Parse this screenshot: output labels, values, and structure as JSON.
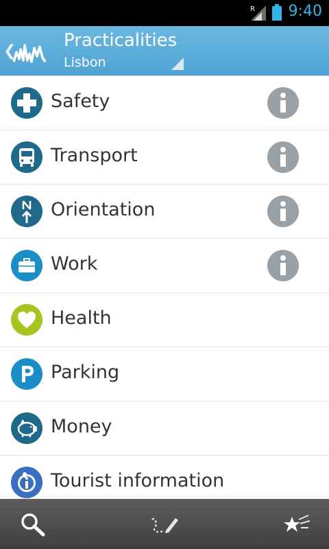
{
  "status_bar": {
    "time": "9:40",
    "signal_glyph": "R"
  },
  "app_bar": {
    "title": "Practicalities",
    "subtitle": "Lisbon",
    "logo_icon": "skyline-logo-icon",
    "back_icon": "chevron-left-icon"
  },
  "list": {
    "items": [
      {
        "label": "Safety",
        "icon": "plus-icon",
        "icon_color": "#1f6a8a",
        "has_info": true
      },
      {
        "label": "Transport",
        "icon": "bus-icon",
        "icon_color": "#1f6a8a",
        "has_info": true
      },
      {
        "label": "Orientation",
        "icon": "north-arrow-icon",
        "icon_color": "#1f6a8a",
        "has_info": true
      },
      {
        "label": "Work",
        "icon": "briefcase-icon",
        "icon_color": "#1b8ec8",
        "has_info": true
      },
      {
        "label": "Health",
        "icon": "heart-icon",
        "icon_color": "#a7c520",
        "has_info": false
      },
      {
        "label": "Parking",
        "icon": "parking-icon",
        "icon_color": "#1b8ec8",
        "has_info": false
      },
      {
        "label": "Money",
        "icon": "piggy-bank-icon",
        "icon_color": "#1f6a8a",
        "has_info": false
      },
      {
        "label": "Tourist information",
        "icon": "tourist-info-icon",
        "icon_color": "#3a6fc0",
        "has_info": false
      }
    ]
  },
  "bottom_bar": {
    "search_icon": "search-icon",
    "route_icon": "route-pencil-icon",
    "favorites_icon": "stars-icon"
  },
  "colors": {
    "accent": "#33b5e5",
    "app_bar": "#5aaedb",
    "info_gray": "#99a1a6",
    "text": "#333333"
  }
}
